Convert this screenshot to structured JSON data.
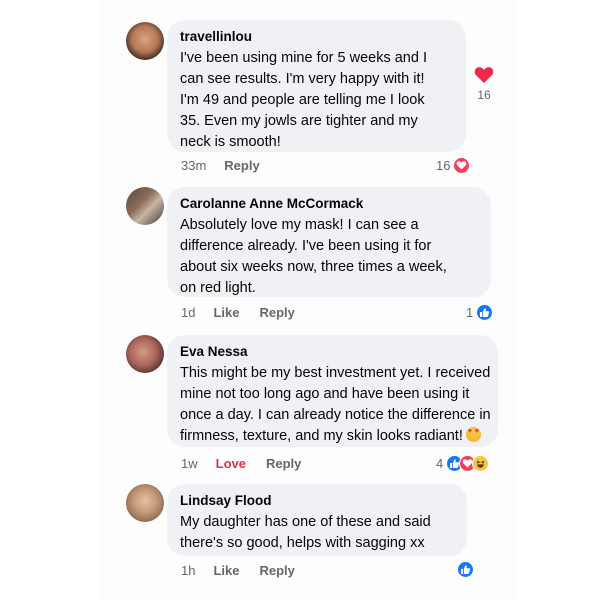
{
  "comments": [
    {
      "author": "travellinlou",
      "lines": [
        "I've been using mine for 5 weeks and I",
        "can see results. I'm very happy with it!",
        "I'm 49 and people are telling me I look",
        "35. Even my jowls are tighter and my",
        "neck is smooth!"
      ],
      "time": "33m",
      "actions": [
        "Reply"
      ],
      "reaction_count": "16",
      "reactions": [
        "love-icon"
      ],
      "side_count": "16"
    },
    {
      "author": "Carolanne Anne McCormack",
      "lines": [
        "Absolutely love my mask! I can see a",
        "difference already. I've been using it for",
        "about six weeks now, three times a week,",
        "on red light."
      ],
      "time": "1d",
      "actions": [
        "Like",
        "Reply"
      ],
      "reaction_count": "1",
      "reactions": [
        "like-icon"
      ]
    },
    {
      "author": "Eva Nessa",
      "lines": [
        "This might be my best investment yet. I received",
        "mine not too long ago and have been using it",
        "once a day. I can already notice the difference in",
        "firmness, texture, and my skin looks radiant!"
      ],
      "time": "1w",
      "actions": [
        "Love",
        "Reply"
      ],
      "reaction_count": "4",
      "reactions": [
        "like-icon",
        "love-icon",
        "haha-icon"
      ]
    },
    {
      "author": "Lindsay Flood",
      "lines": [
        "My daughter has one of these and said",
        "there's so good, helps with sagging xx"
      ],
      "time": "1h",
      "actions": [
        "Like",
        "Reply"
      ],
      "reaction_count": "",
      "reactions": [
        "like-icon"
      ]
    }
  ],
  "colors": {
    "bubble": "#eff1f4",
    "like": "#1877f2",
    "love": "#f33e58",
    "muted": "#65676b"
  }
}
